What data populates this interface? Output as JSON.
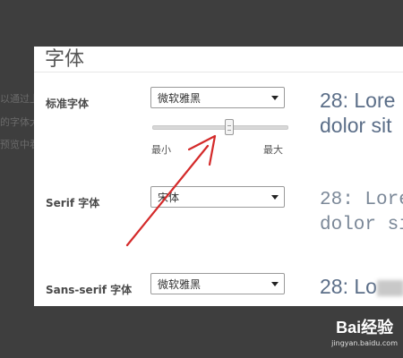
{
  "background": {
    "fragments": [
      "以通过上",
      "的字体大",
      "预览中看"
    ]
  },
  "dialog": {
    "title": "字体",
    "standard_font": {
      "label": "标准字体",
      "selected": "微软雅黑",
      "slider": {
        "min_label": "最小",
        "max_label": "最大",
        "level_fraction": 0.58
      },
      "preview": [
        "28: Lore",
        "dolor sit"
      ]
    },
    "serif_font": {
      "label": "Serif 字体",
      "selected": "宋体",
      "preview": [
        "28: Lore",
        "dolor si"
      ]
    },
    "sans_serif_font": {
      "label": "Sans-serif 字体",
      "selected": "微软雅黑",
      "preview": [
        "28: Lo"
      ]
    }
  },
  "watermark": {
    "logo": "Bai经验",
    "url": "jingyan.baidu.com"
  },
  "colors": {
    "overlay": "#3e3e3e",
    "dialog_bg": "#ffffff",
    "preview_text": "#5b6e88",
    "annotation_arrow": "#d42a2a"
  },
  "icons": {
    "dropdown": "chevron-down-icon",
    "annotation": "red-arrow-annotation"
  }
}
